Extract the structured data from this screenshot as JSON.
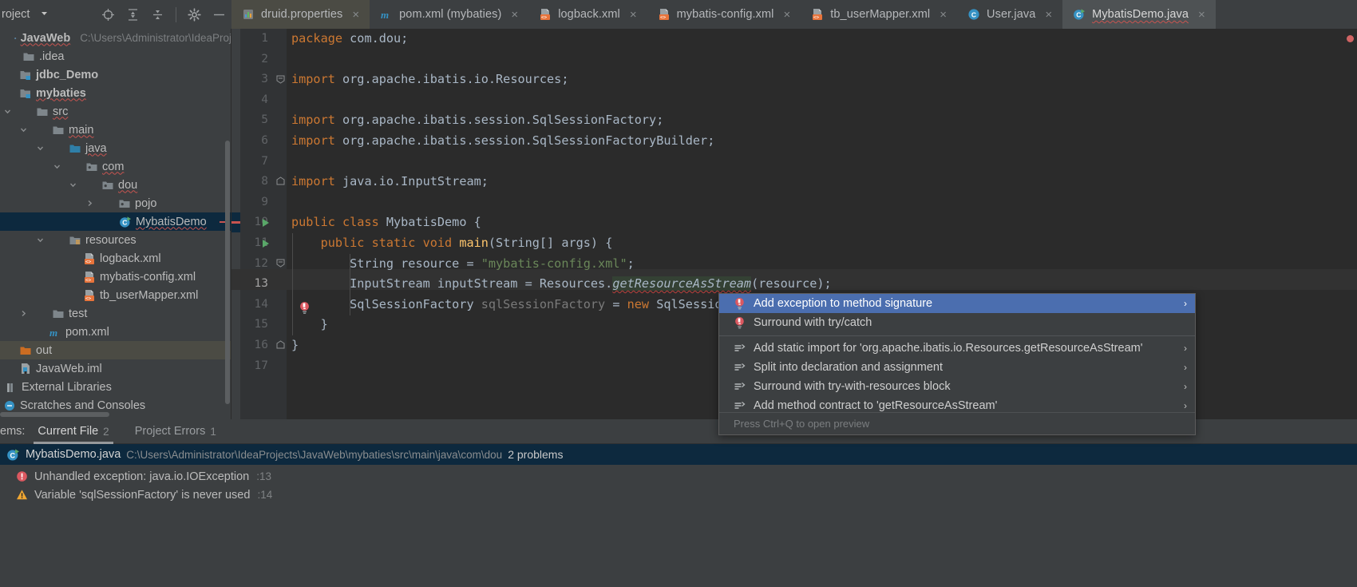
{
  "toolwindow": {
    "title": "roject",
    "caret": "chevron-down-icon",
    "icons": [
      "locate-icon",
      "expand-all-icon",
      "collapse-all-icon",
      "settings-gear-icon",
      "hide-icon"
    ]
  },
  "tabs": [
    {
      "label": "druid.properties",
      "icon": "properties-file-icon",
      "state": "modified",
      "close": "×"
    },
    {
      "label": "pom.xml (mybaties)",
      "icon": "maven-file-icon",
      "state": "normal",
      "close": "×"
    },
    {
      "label": "logback.xml",
      "icon": "xml-file-icon",
      "state": "normal",
      "close": "×"
    },
    {
      "label": "mybatis-config.xml",
      "icon": "xml-file-icon",
      "state": "normal",
      "close": "×"
    },
    {
      "label": "tb_userMapper.xml",
      "icon": "xml-file-icon",
      "state": "normal",
      "close": "×"
    },
    {
      "label": "User.java",
      "icon": "java-class-icon",
      "state": "normal",
      "close": "×"
    },
    {
      "label": "MybatisDemo.java",
      "icon": "java-runnable-class-icon",
      "state": "selected",
      "close": "×"
    }
  ],
  "project_tree": [
    {
      "label": "JavaWeb",
      "path": "C:\\Users\\Administrator\\IdeaProj",
      "icon": "project-icon",
      "indent": 0,
      "arrow": "none",
      "bold": true,
      "squiggle": true,
      "state": "normal"
    },
    {
      "label": ".idea",
      "icon": "folder-icon",
      "indent": 1,
      "arrow": "none",
      "state": "normal"
    },
    {
      "label": "jdbc_Demo",
      "icon": "module-folder-icon",
      "indent": 1,
      "arrow": "none",
      "bold": true,
      "state": "normal"
    },
    {
      "label": "mybaties",
      "icon": "module-folder-icon",
      "indent": 1,
      "arrow": "none",
      "bold": true,
      "squiggle": true,
      "state": "normal"
    },
    {
      "label": "src",
      "icon": "folder-icon",
      "indent": 2,
      "arrow": "expanded",
      "squiggle": true,
      "state": "normal"
    },
    {
      "label": "main",
      "icon": "folder-icon",
      "indent": 3,
      "arrow": "expanded",
      "squiggle": true,
      "state": "normal"
    },
    {
      "label": "java",
      "icon": "source-root-folder-icon",
      "indent": 4,
      "arrow": "expanded",
      "squiggle": true,
      "state": "normal"
    },
    {
      "label": "com",
      "icon": "package-icon",
      "indent": 5,
      "arrow": "expanded",
      "squiggle": true,
      "state": "normal"
    },
    {
      "label": "dou",
      "icon": "package-icon",
      "indent": 6,
      "arrow": "expanded",
      "squiggle": true,
      "state": "normal"
    },
    {
      "label": "pojo",
      "icon": "package-icon",
      "indent": 7,
      "arrow": "collapsed",
      "state": "normal"
    },
    {
      "label": "MybatisDemo",
      "icon": "java-runnable-class-icon",
      "indent": 8,
      "arrow": "none",
      "squiggle": true,
      "state": "selected"
    },
    {
      "label": "resources",
      "icon": "resource-root-folder-icon",
      "indent": 4,
      "arrow": "expanded",
      "state": "normal"
    },
    {
      "label": "logback.xml",
      "icon": "xml-file-icon",
      "indent": 5,
      "arrow": "none",
      "state": "normal"
    },
    {
      "label": "mybatis-config.xml",
      "icon": "xml-file-icon",
      "indent": 5,
      "arrow": "none",
      "state": "normal"
    },
    {
      "label": "tb_userMapper.xml",
      "icon": "xml-file-icon",
      "indent": 5,
      "arrow": "none",
      "state": "normal"
    },
    {
      "label": "test",
      "icon": "folder-icon",
      "indent": 3,
      "arrow": "collapsed",
      "state": "normal"
    },
    {
      "label": "pom.xml",
      "icon": "maven-file-icon",
      "indent": 3,
      "arrow": "none",
      "state": "normal"
    },
    {
      "label": "out",
      "icon": "excluded-folder-icon",
      "indent": 1,
      "arrow": "none",
      "state": "highlighted"
    },
    {
      "label": "JavaWeb.iml",
      "icon": "iml-file-icon",
      "indent": 1,
      "arrow": "none",
      "state": "normal"
    },
    {
      "label": "External Libraries",
      "icon": "library-icon",
      "indent": 0,
      "arrow": "none",
      "state": "normal"
    },
    {
      "label": "Scratches and Consoles",
      "icon": "scratches-icon",
      "indent": 0,
      "arrow": "none",
      "state": "normal"
    }
  ],
  "editor": {
    "filename": "MybatisDemo.java",
    "lines": [
      {
        "n": 1,
        "segs": [
          [
            "kw",
            "package"
          ],
          [
            "",
            " com.dou;"
          ]
        ]
      },
      {
        "n": 2,
        "segs": []
      },
      {
        "n": 3,
        "segs": [
          [
            "kw",
            "import"
          ],
          [
            "",
            " org.apache.ibatis.io.Resources;"
          ]
        ],
        "fold": "start"
      },
      {
        "n": 4,
        "segs": []
      },
      {
        "n": 5,
        "segs": [
          [
            "kw",
            "import"
          ],
          [
            "",
            " org.apache.ibatis.session.SqlSessionFactory;"
          ]
        ]
      },
      {
        "n": 6,
        "segs": [
          [
            "kw",
            "import"
          ],
          [
            "",
            " org.apache.ibatis.session.SqlSessionFactoryBuilder;"
          ]
        ]
      },
      {
        "n": 7,
        "segs": []
      },
      {
        "n": 8,
        "segs": [
          [
            "kw",
            "import"
          ],
          [
            "",
            " java.io.InputStream;"
          ]
        ],
        "fold": "end"
      },
      {
        "n": 9,
        "segs": []
      },
      {
        "n": 10,
        "segs": [
          [
            "kw",
            "public class"
          ],
          [
            "",
            " MybatisDemo {"
          ]
        ],
        "run": true
      },
      {
        "n": 11,
        "segs": [
          [
            "",
            "    "
          ],
          [
            "kw",
            "public static void"
          ],
          [
            "",
            " "
          ],
          [
            "mth",
            "main"
          ],
          [
            "",
            "(String[] args) {"
          ]
        ],
        "run": true,
        "fold": "start"
      },
      {
        "n": 12,
        "segs": [
          [
            "",
            "        String resource = "
          ],
          [
            "str",
            "\"mybatis-config.xml\""
          ],
          [
            "",
            ";"
          ]
        ]
      },
      {
        "n": 13,
        "segs": [
          [
            "",
            "        InputStream inputStream = Resources."
          ],
          [
            "static",
            "getResourceAsStream"
          ],
          [
            "",
            "(resource);"
          ]
        ],
        "bulb": true,
        "current": true
      },
      {
        "n": 14,
        "segs": [
          [
            "",
            "        SqlSessionFactory "
          ],
          [
            "dim",
            "sqlSessionFactory"
          ],
          [
            "",
            " = "
          ],
          [
            "kw",
            "new"
          ],
          [
            "",
            " SqlSessionFactoryBuilder().build(inputStream);"
          ]
        ]
      },
      {
        "n": 15,
        "segs": [
          [
            "",
            "    }"
          ]
        ],
        "fold": "end"
      },
      {
        "n": 16,
        "segs": [
          [
            "",
            "}"
          ]
        ]
      },
      {
        "n": 17,
        "segs": []
      }
    ]
  },
  "intention_popup": {
    "items": [
      {
        "label": "Add exception to method signature",
        "icon": "quickfix-bulb-icon",
        "selected": true,
        "chevron": "›"
      },
      {
        "label": "Surround with try/catch",
        "icon": "quickfix-bulb-icon",
        "selected": false,
        "chevron": ""
      },
      {
        "separator": true
      },
      {
        "label": "Add static import for 'org.apache.ibatis.io.Resources.getResourceAsStream'",
        "icon": "intention-icon",
        "selected": false,
        "chevron": "›"
      },
      {
        "label": "Split into declaration and assignment",
        "icon": "intention-icon",
        "selected": false,
        "chevron": "›"
      },
      {
        "label": "Surround with try-with-resources block",
        "icon": "intention-icon",
        "selected": false,
        "chevron": "›"
      },
      {
        "label": "Add method contract to 'getResourceAsStream'",
        "icon": "intention-icon",
        "selected": false,
        "chevron": "›"
      }
    ],
    "footer_hint": "Press Ctrl+Q to open preview"
  },
  "problems_panel": {
    "header_label": "ems:",
    "tabs": [
      {
        "label": "Current File",
        "count": "2",
        "active": true
      },
      {
        "label": "Project Errors",
        "count": "1",
        "active": false
      }
    ],
    "file_row": {
      "icon": "java-runnable-class-icon",
      "filename": "MybatisDemo.java",
      "path": "C:\\Users\\Administrator\\IdeaProjects\\JavaWeb\\mybaties\\src\\main\\java\\com\\dou",
      "count_text": "2 problems"
    },
    "problems": [
      {
        "severity": "error",
        "text": "Unhandled exception: java.io.IOException",
        "line": ":13"
      },
      {
        "severity": "warning",
        "text": "Variable 'sqlSessionFactory' is never used",
        "line": ":14"
      }
    ]
  },
  "colors": {
    "ide_bg": "#3c3f41",
    "editor_bg": "#2b2b2b",
    "gutter_bg": "#313335",
    "selection_blue": "#0d293e",
    "popup_selection": "#4b6eaf",
    "keyword_orange": "#cc7832",
    "string_green": "#6a8759",
    "method_yellow": "#ffc66d",
    "text_default": "#a9b7c6",
    "error_red": "#c75450",
    "warning_yellow": "#f0a732"
  }
}
